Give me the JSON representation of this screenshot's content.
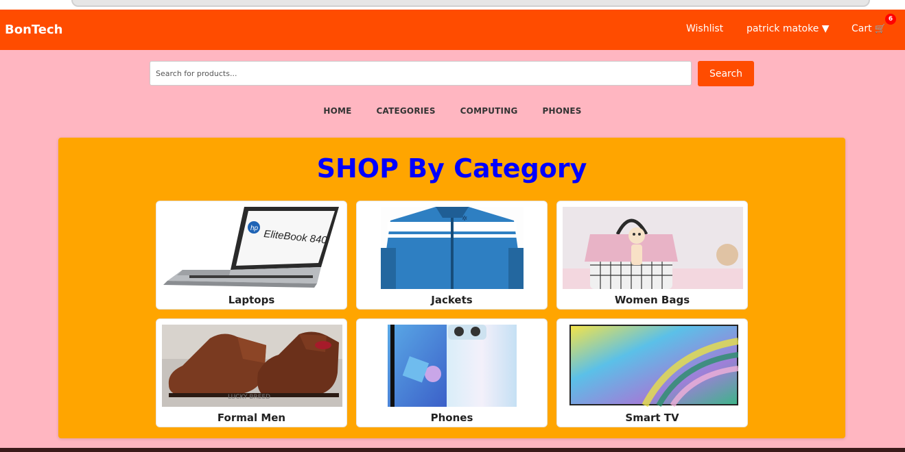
{
  "header": {
    "brand": "BonTech",
    "wishlist_label": "Wishlist",
    "user_label": "patrick matoke ▼",
    "cart_label": "Cart",
    "cart_count": "6"
  },
  "search": {
    "placeholder": "Search for products...",
    "button_label": "Search"
  },
  "menu": {
    "items": [
      "HOME",
      "CATEGORIES",
      "COMPUTING",
      "PHONES"
    ]
  },
  "categories": {
    "title": "SHOP By Category",
    "items": [
      {
        "label": "Laptops",
        "image": "laptop-image"
      },
      {
        "label": "Jackets",
        "image": "jacket-image"
      },
      {
        "label": "Women Bags",
        "image": "handbag-image"
      },
      {
        "label": "Formal Men",
        "image": "formal-shoes-image"
      },
      {
        "label": "Phones",
        "image": "phone-image"
      },
      {
        "label": "Smart TV",
        "image": "smart-tv-image"
      }
    ]
  },
  "colors": {
    "header_bg": "#ff4c00",
    "page_bg": "#ffb6c1",
    "panel_bg": "#ffa500",
    "title_color": "#0000ff",
    "badge_bg": "#ff0000"
  }
}
